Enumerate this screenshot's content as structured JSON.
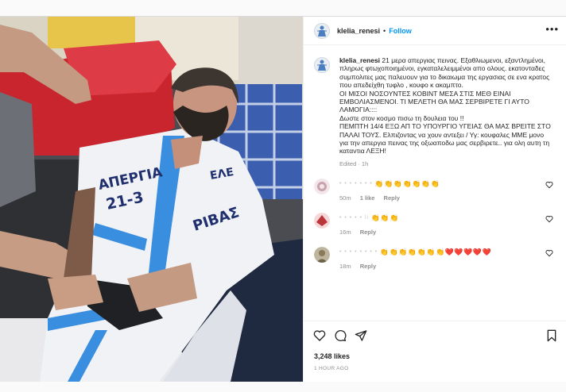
{
  "post": {
    "username": "klelia_renesi",
    "follow_label": "Follow",
    "separator": "•",
    "more_label": "•••"
  },
  "caption": {
    "username": "klelia_renesi",
    "text": " 21 μερα απεργιας πεινας. Εξαθλιωμενοι, εξαντλημένοι, πληρως φτωχοποιημένοι, εγκαταλελειμμένοι απο ολους. εκατονταδες συμπολιτες μας παλευουν για το δικαιωμα της εργασιας σε ενα κρατος που απεδείχθη τυφλο , κουφο κ ακαμπτο.\nΟΙ ΜΙΣΟΙ ΝΟΣΟΥΝΤΕΣ ΚΟΒΙΝΤ ΜΕΣΑ ΣΤΙΣ ΜΕΘ ΕΙΝΑΙ ΕΜΒΟΛΙΑΣΜΕΝΟΙ. ΤΙ ΜΕΛΕΤΗ ΘΑ ΜΑΣ ΣΕΡΒΙΡΕΤΕ ΓΙ ΑΥΤΟ ΛΑΜΟΓΙΑ::::\nΔωστε στον κοσμο πισω τη δουλεια του !!\nΠΕΜΠΤΗ 14/4 ΕΞΩ ΑΠ ΤΟ ΥΠΟΥΡΓΙΟ ΥΓΕΙΑΣ ΘΑ ΜΑΣ ΒΡΕΙΤΕ ΣΤΟ ΠΑΛΑΙ ΤΟΥΣ. Ελπιζοντας να χουν αντεξει / Υγ: κουφαλες ΜΜΕ μονο για την απεργια πεινας της οξωαποδω μας σερβιρετε.. για ολη αυτη τη καταντια ΛΕΞΗ!",
    "meta": "Edited · 1h"
  },
  "comments": [
    {
      "name": "• • • • • • •",
      "emoji": "👏👏👏👏👏👏👏",
      "time": "50m",
      "likes": "1 like",
      "reply": "Reply",
      "avatar_color": "#c9a3ad"
    },
    {
      "name": "• • • • • li",
      "emoji": "👏👏👏",
      "time": "16m",
      "likes": "",
      "reply": "Reply",
      "avatar_color": "#b9373a"
    },
    {
      "name": "• • • • • • • •",
      "emoji": "👏👏👏👏👏👏👏❤️❤️❤️❤️❤️",
      "time": "18m",
      "likes": "",
      "reply": "Reply",
      "avatar_color": "#8a7a5c"
    }
  ],
  "photo": {
    "writing_1": "ΑΠΕΡΓΙΑ",
    "writing_2": "21-3",
    "writing_3": "ΕΛΕ",
    "writing_4": "ΡΙΒΑΣ"
  },
  "footer": {
    "likes": "3,248 likes",
    "time": "1 HOUR AGO"
  },
  "colors": {
    "accent": "#0095f6",
    "text": "#262626",
    "muted": "#8e8e8e"
  },
  "icons": [
    "heart-icon",
    "comment-icon",
    "share-icon",
    "bookmark-icon",
    "more-icon"
  ]
}
